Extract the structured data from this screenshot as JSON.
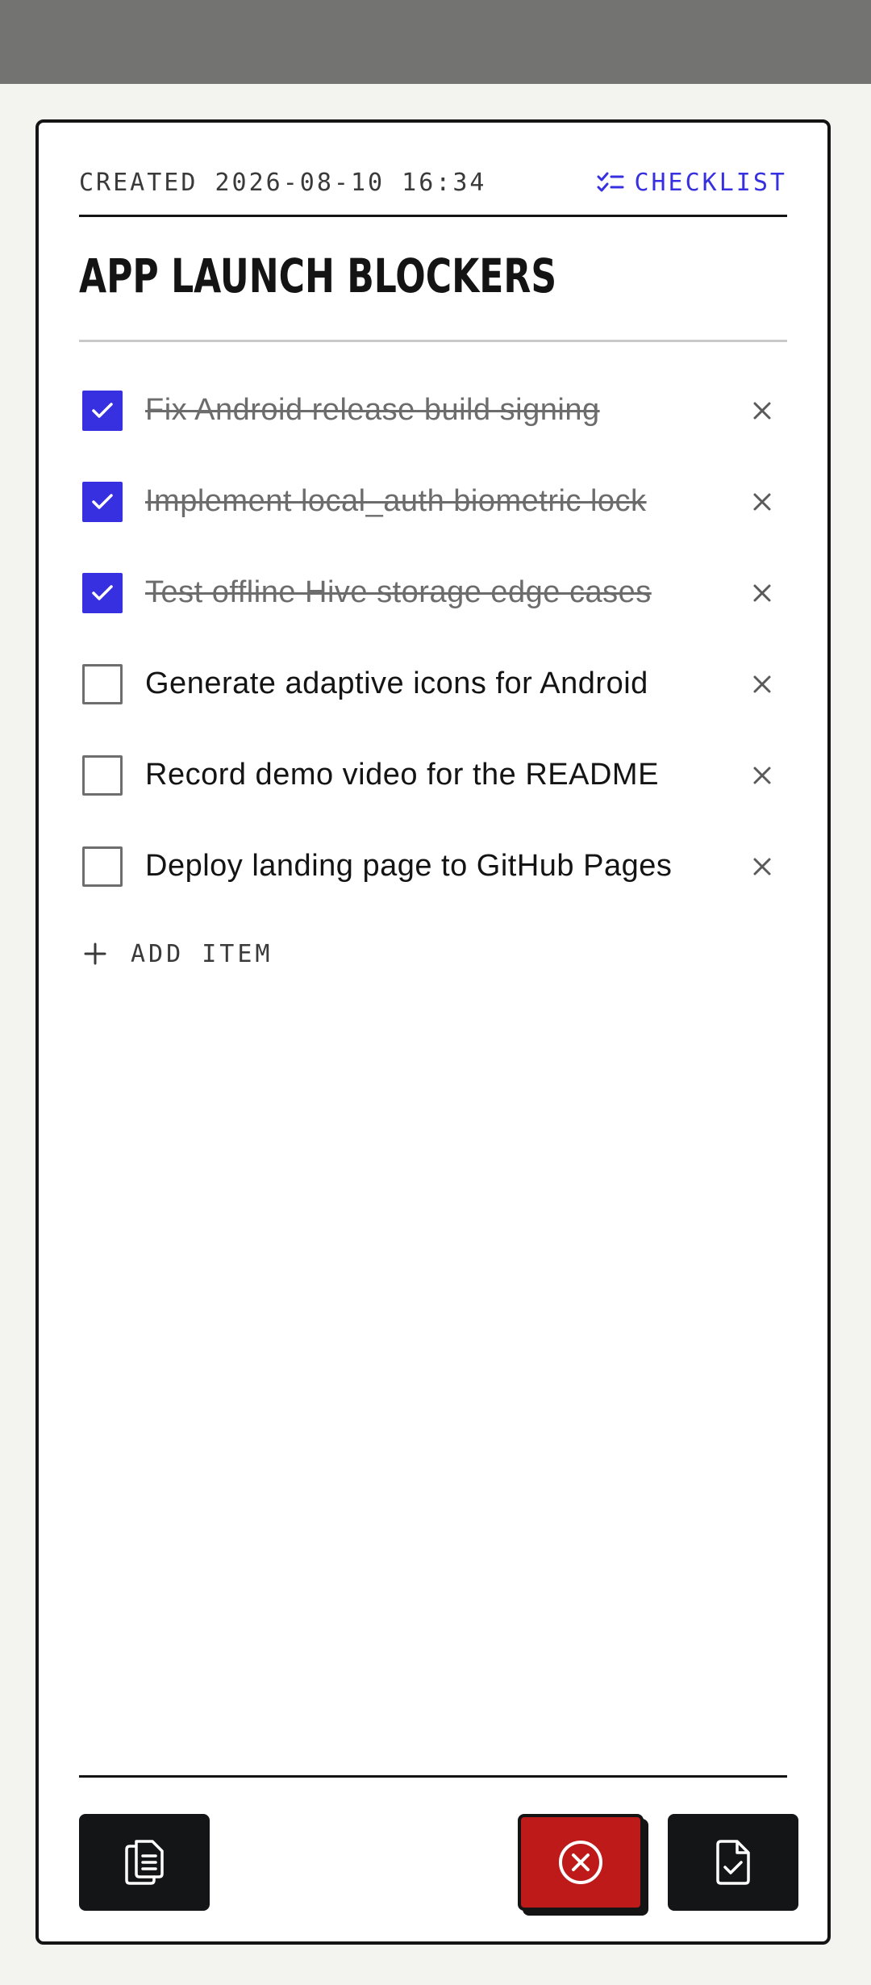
{
  "note": {
    "created_label": "CREATED 2026-08-10 16:34",
    "type_label": "CHECKLIST",
    "type_icon": "checklist-icon",
    "title": "APP LAUNCH BLOCKERS",
    "items": [
      {
        "text": "Fix Android release build signing",
        "checked": true
      },
      {
        "text": "Implement local_auth biometric lock",
        "checked": true
      },
      {
        "text": "Test offline Hive storage edge cases",
        "checked": true
      },
      {
        "text": "Generate adaptive icons for Android",
        "checked": false
      },
      {
        "text": "Record demo video for the README",
        "checked": false
      },
      {
        "text": "Deploy landing page to GitHub Pages",
        "checked": false
      }
    ],
    "add_item_label": "ADD ITEM"
  },
  "actions": {
    "copy_icon": "copy-document-icon",
    "discard_icon": "circle-x-icon",
    "save_icon": "document-check-icon"
  },
  "colors": {
    "accent": "#3730e0",
    "danger": "#be1a1a",
    "ink": "#141414",
    "background": "#f3f3ef"
  }
}
